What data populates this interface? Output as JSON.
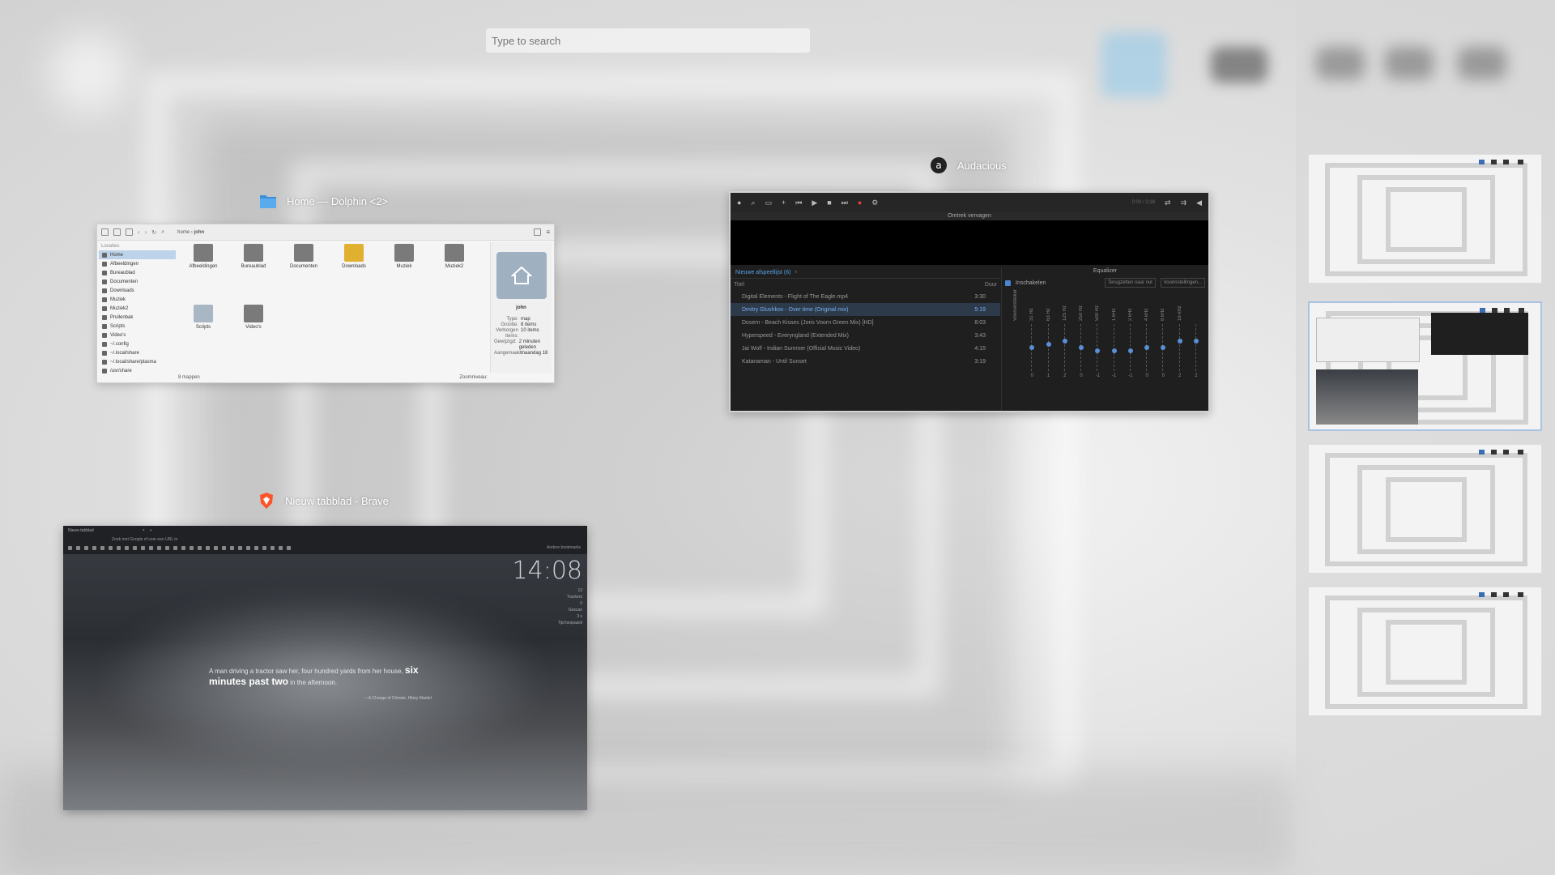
{
  "search": {
    "placeholder": "Type to search"
  },
  "windows": {
    "dolphin": {
      "caption": "Home — Dolphin <2>",
      "breadcrumb": [
        "home",
        "john"
      ],
      "places_header": "Locaties",
      "places": [
        "Home",
        "Afbeeldingen",
        "Bureaublad",
        "Documenten",
        "Downloads",
        "Muziek",
        "Muziek2",
        "Prullenbak",
        "Scripts",
        "Video's",
        "~/.config",
        "~/.local/share",
        "~/.local/share/plasma",
        "/usr/share"
      ],
      "files": [
        {
          "name": "Afbeeldingen",
          "style": "dark"
        },
        {
          "name": "Bureaublad",
          "style": "dark"
        },
        {
          "name": "Documenten",
          "style": "dark"
        },
        {
          "name": "Downloads",
          "style": "yellow"
        },
        {
          "name": "Muziek",
          "style": "dark"
        },
        {
          "name": "Muziek2",
          "style": "dark"
        },
        {
          "name": "Scripts",
          "style": "grey"
        },
        {
          "name": "Video's",
          "style": "dark"
        }
      ],
      "info_title": "john",
      "info_rows": [
        {
          "k": "Type:",
          "v": "map"
        },
        {
          "k": "Grootte:",
          "v": "8 items"
        },
        {
          "k": "Verborgen items:",
          "v": "10 items"
        },
        {
          "k": "Gewijzigd:",
          "v": "2 minuten geleden"
        },
        {
          "k": "Aangemaakt:",
          "v": "maandag 18"
        }
      ],
      "status_left": "8 mappen",
      "status_zoom": "Zoomniveau:"
    },
    "audacious": {
      "caption": "Audacious",
      "viz_title": "Omtrek vervagen",
      "time": "0:00 / 3:38",
      "playlist_tab": "Nieuwe afspeellijst (6)",
      "col_title": "Titel",
      "col_duration": "Duur",
      "tracks": [
        {
          "title": "Digital Elements - Flight of The Eagle.mp4",
          "dur": "3:30",
          "selected": false
        },
        {
          "title": "Dmitry Glushkov - Over time (Original mix)",
          "dur": "5:19",
          "selected": true
        },
        {
          "title": "Dosem - Beach Kisses (Joris Voorn Green Mix) [HD]",
          "dur": "8:03",
          "selected": false
        },
        {
          "title": "Hyperspeed - Everyngland (Extended Mix)",
          "dur": "3:43",
          "selected": false
        },
        {
          "title": "Jai Wolf - Indian Summer (Official Music Video)",
          "dur": "4:15",
          "selected": false
        },
        {
          "title": "Katanaman - Until Sunset",
          "dur": "3:19",
          "selected": false
        }
      ],
      "eq_title": "Equalizer",
      "eq_enable": "Inschakelen",
      "eq_reset": "Terugzetten naar nul",
      "eq_presets": "Voorinstellingen...",
      "eq_preamp": "Voorversterker",
      "bands": [
        {
          "label": "31 Hz",
          "val": "0"
        },
        {
          "label": "63 Hz",
          "val": "1"
        },
        {
          "label": "125 Hz",
          "val": "2"
        },
        {
          "label": "250 Hz",
          "val": "0"
        },
        {
          "label": "500 Hz",
          "val": "-1"
        },
        {
          "label": "1 kHz",
          "val": "-1"
        },
        {
          "label": "2 kHz",
          "val": "-1"
        },
        {
          "label": "4 kHz",
          "val": "0"
        },
        {
          "label": "8 kHz",
          "val": "0"
        },
        {
          "label": "16 kHz",
          "val": "2"
        },
        {
          "label": "",
          "val": "2"
        }
      ]
    },
    "brave": {
      "caption": "Nieuw tabblad - Brave",
      "tab_title": "Nieuw tabblad",
      "url_placeholder": "Zoek met Google of voer een URL in",
      "bookmarks_label": "Andere bookmarks",
      "clock": "14:08",
      "stats": [
        "13",
        "Trackers",
        "0",
        "Gescan",
        "3 s",
        "Tijd bespaard"
      ],
      "quote_pre": "A man driving a tractor saw her, four hundred yards from her house,",
      "quote_bold": "six minutes past two",
      "quote_post": "in the afternoon.",
      "cite": "—A Change of Climate, Hilary Mantel"
    }
  },
  "colors": {
    "accent": "#3b82f6",
    "audacious_selection": "#79aef0"
  },
  "desktops": [
    {
      "active": false
    },
    {
      "active": true
    },
    {
      "active": false
    },
    {
      "active": false
    }
  ]
}
